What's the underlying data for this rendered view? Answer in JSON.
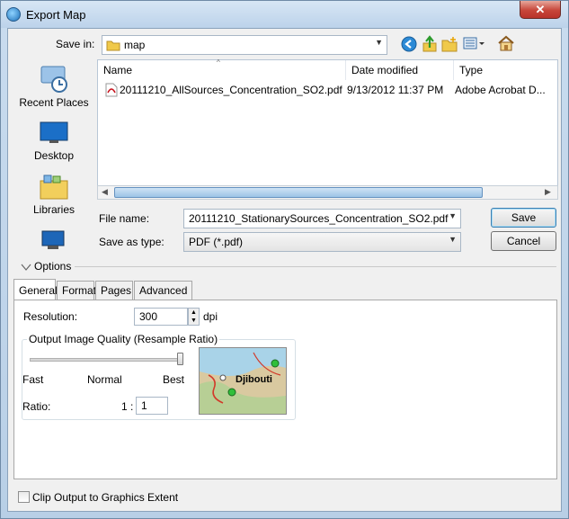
{
  "window": {
    "title": "Export Map",
    "close_glyph": "✕"
  },
  "save_in": {
    "label": "Save in:",
    "value": "map"
  },
  "places": [
    {
      "label": "Recent Places"
    },
    {
      "label": "Desktop"
    },
    {
      "label": "Libraries"
    }
  ],
  "file_list": {
    "columns": [
      "Name",
      "Date modified",
      "Type"
    ],
    "rows": [
      {
        "name": "20111210_AllSources_Concentration_SO2.pdf",
        "date": "9/13/2012 11:37 PM",
        "type": "Adobe Acrobat D..."
      }
    ]
  },
  "file_name": {
    "label": "File name:",
    "value": "20111210_StationarySources_Concentration_SO2.pdf"
  },
  "save_as_type": {
    "label": "Save as type:",
    "value": "PDF (*.pdf)"
  },
  "buttons": {
    "save": "Save",
    "cancel": "Cancel"
  },
  "options": {
    "label": "Options"
  },
  "tabs": [
    "General",
    "Format",
    "Pages",
    "Advanced"
  ],
  "general": {
    "resolution_label": "Resolution:",
    "resolution_value": "300",
    "resolution_unit": "dpi",
    "quality_group_label": "Output Image Quality (Resample Ratio)",
    "quality_slider_value": 1.0,
    "slider_labels": {
      "fast": "Fast",
      "normal": "Normal",
      "best": "Best"
    },
    "ratio_label": "Ratio:",
    "ratio_prefix": "1 :",
    "ratio_value": "1",
    "preview_label": "Djibouti"
  },
  "clip_output": {
    "label": "Clip Output to Graphics Extent",
    "checked": false
  },
  "icons": [
    "app-globe-icon",
    "close-icon",
    "folder-icon",
    "back-icon",
    "up-folder-icon",
    "new-folder-icon",
    "view-menu-icon",
    "home-icon",
    "recent-places-icon",
    "desktop-icon",
    "libraries-icon",
    "computer-icon",
    "pdf-file-icon",
    "options-collapse-icon"
  ]
}
